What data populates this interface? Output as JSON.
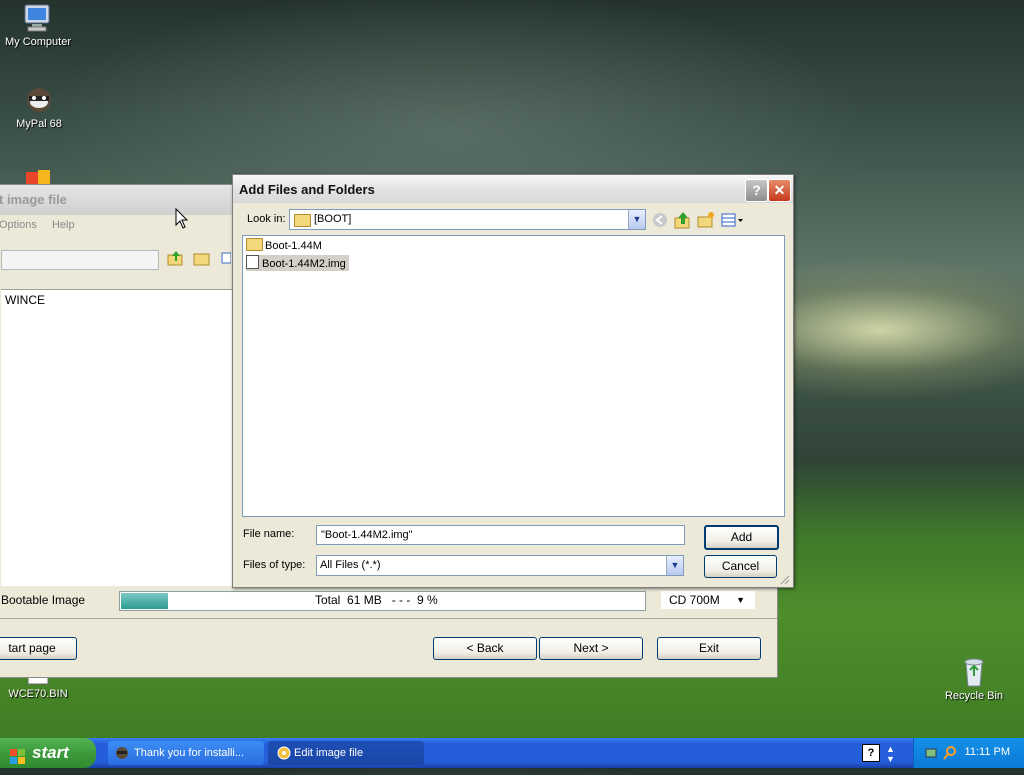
{
  "desktop": {
    "icons": [
      {
        "label": "My Computer"
      },
      {
        "label": "MyPal 68"
      },
      {
        "label": "WCE70.BIN"
      },
      {
        "label": "Recycle Bin"
      }
    ]
  },
  "editor_window": {
    "title": "Edit image file",
    "title_visible": "t image file",
    "menu": [
      "Options",
      "Help"
    ],
    "tree_node": "WINCE",
    "bootable_label": "Bootable Image",
    "progress_percent": 9,
    "progress_text": "Total  61 MB   - - -  9 %",
    "media_select": "CD 700M",
    "buttons": {
      "start_page": "Start page",
      "start_page_visible": "tart page",
      "back": "< Back",
      "next": "Next >",
      "exit": "Exit"
    }
  },
  "dialog": {
    "title": "Add Files and Folders",
    "look_in_label": "Look in:",
    "look_in_value": "[BOOT]",
    "files": [
      {
        "name": "Boot-1.44M",
        "type": "folder",
        "selected": false
      },
      {
        "name": "Boot-1.44M2.img",
        "type": "file",
        "selected": true
      }
    ],
    "file_name_label": "File name:",
    "file_name_value": "\"Boot-1.44M2.img\"",
    "files_of_type_label": "Files of type:",
    "files_of_type_value": "All Files (*.*)",
    "add_button": "Add",
    "cancel_button": "Cancel"
  },
  "taskbar": {
    "start_label": "start",
    "tasks": [
      {
        "label": "Thank you for installi..."
      },
      {
        "label": "Edit image file"
      }
    ],
    "clock": "11:11 PM"
  }
}
